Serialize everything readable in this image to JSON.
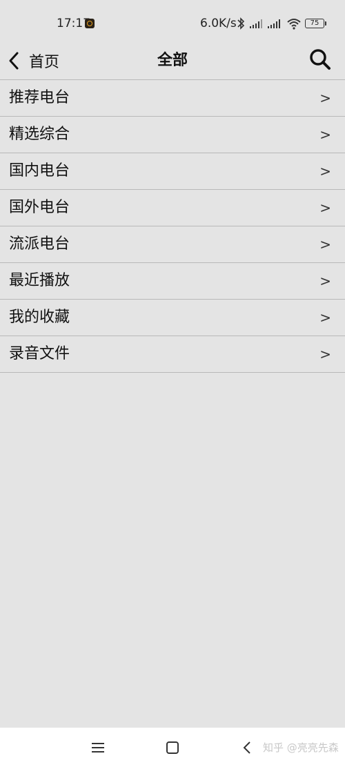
{
  "status_bar": {
    "time": "17:17",
    "net_speed": "6.0K/s",
    "battery": "75",
    "icons": [
      "app-notification-icon",
      "bluetooth-icon",
      "signal-icon",
      "signal-icon",
      "wifi-icon",
      "battery-icon"
    ]
  },
  "header": {
    "back_label": "首页",
    "title": "全部"
  },
  "menu": {
    "items": [
      {
        "label": "推荐电台",
        "chevron": ">"
      },
      {
        "label": "精选综合",
        "chevron": ">"
      },
      {
        "label": "国内电台",
        "chevron": ">"
      },
      {
        "label": "国外电台",
        "chevron": ">"
      },
      {
        "label": "流派电台",
        "chevron": ">"
      },
      {
        "label": "最近播放",
        "chevron": ">"
      },
      {
        "label": "我的收藏",
        "chevron": ">"
      },
      {
        "label": "录音文件",
        "chevron": ">"
      }
    ]
  },
  "watermark": "知乎 @亮亮先森",
  "colors": {
    "background": "#e4e4e4",
    "divider": "#b8b8b8",
    "nav_bar": "#ffffff"
  }
}
